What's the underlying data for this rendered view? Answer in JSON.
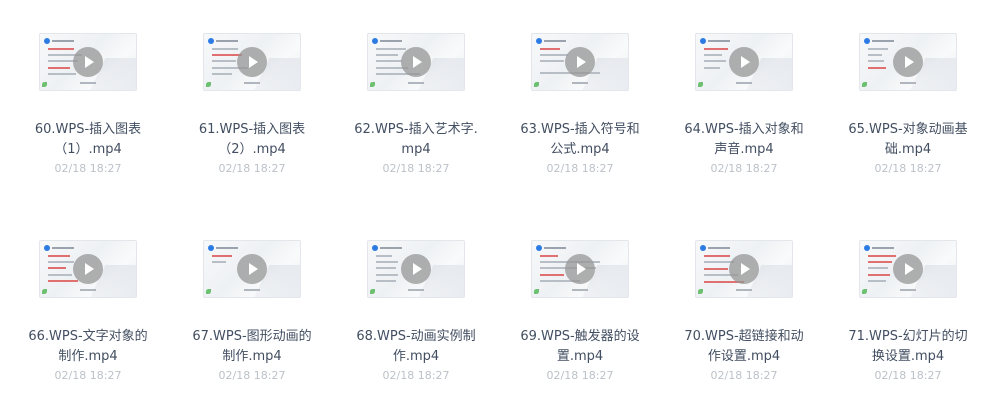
{
  "files": [
    {
      "name": "60.WPS-插入图表（1）.mp4",
      "date": "02/18 18:27"
    },
    {
      "name": "61.WPS-插入图表（2）.mp4",
      "date": "02/18 18:27"
    },
    {
      "name": "62.WPS-插入艺术字.mp4",
      "date": "02/18 18:27"
    },
    {
      "name": "63.WPS-插入符号和公式.mp4",
      "date": "02/18 18:27"
    },
    {
      "name": "64.WPS-插入对象和声音.mp4",
      "date": "02/18 18:27"
    },
    {
      "name": "65.WPS-对象动画基础.mp4",
      "date": "02/18 18:27"
    },
    {
      "name": "66.WPS-文字对象的制作.mp4",
      "date": "02/18 18:27"
    },
    {
      "name": "67.WPS-图形动画的制作.mp4",
      "date": "02/18 18:27"
    },
    {
      "name": "68.WPS-动画实例制作.mp4",
      "date": "02/18 18:27"
    },
    {
      "name": "69.WPS-触发器的设置.mp4",
      "date": "02/18 18:27"
    },
    {
      "name": "70.WPS-超链接和动作设置.mp4",
      "date": "02/18 18:27"
    },
    {
      "name": "71.WPS-幻灯片的切换设置.mp4",
      "date": "02/18 18:27"
    }
  ],
  "icons": {
    "play": "play-icon"
  }
}
